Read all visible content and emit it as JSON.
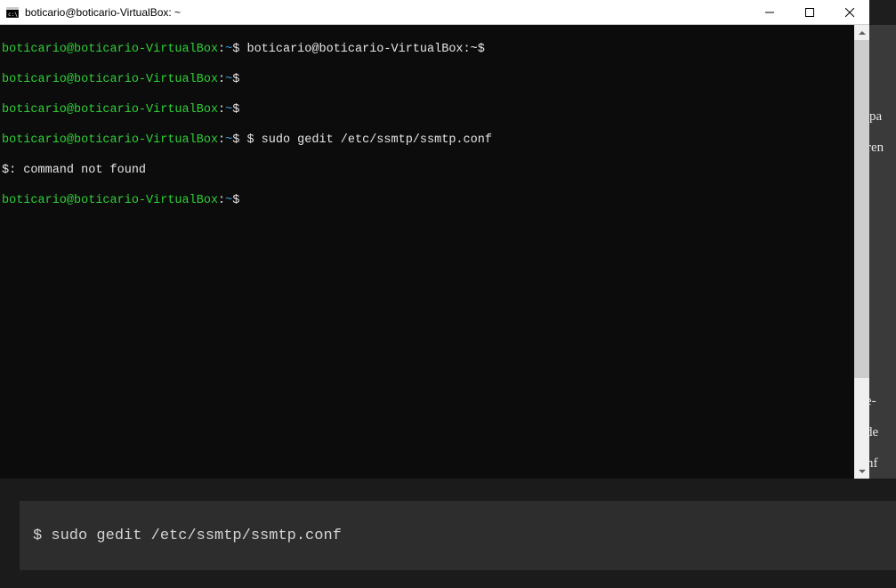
{
  "titlebar": {
    "title": "boticario@boticario-VirtualBox: ~"
  },
  "prompt": {
    "user_host": "boticario@boticario-VirtualBox",
    "colon": ":",
    "path": "~",
    "dollar": "$"
  },
  "lines": {
    "l1_echo": " boticario@boticario-VirtualBox:~$",
    "l4_cmd": " $ sudo gedit /etc/ssmtp/ssmtp.conf",
    "l5_err": "$: command not found"
  },
  "background": {
    "frag1": " pa",
    "frag2": "ren",
    "frag3": "  e-",
    "frag4": "  de",
    "frag5": "nf "
  },
  "codebox": {
    "content": "$ sudo gedit /etc/ssmtp/ssmtp.conf"
  }
}
